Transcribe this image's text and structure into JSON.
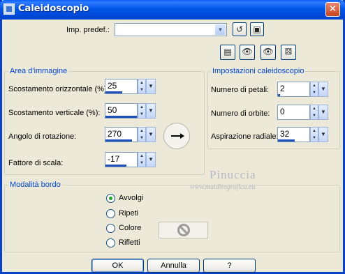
{
  "window": {
    "title": "Caleidoscopio",
    "close_glyph": "✕",
    "accent": "#0054e3"
  },
  "presets": {
    "label": "Imp. predef.:",
    "value": "",
    "icons": [
      "reset-icon",
      "save-icon"
    ]
  },
  "toolbar": {
    "icons": [
      "dialog-settings-icon",
      "preview-left-icon",
      "preview-right-icon",
      "random-dice-icon"
    ]
  },
  "image_area": {
    "title": "Area d'immagine",
    "fields": [
      {
        "label": "Scostamento orizzontale (%):",
        "value": "25"
      },
      {
        "label": "Scostamento verticale (%):",
        "value": "50"
      },
      {
        "label": "Angolo di rotazione:",
        "value": "270"
      },
      {
        "label": "Fattore di scala:",
        "value": "-17"
      }
    ]
  },
  "kaleido_settings": {
    "title": "Impostazioni caleidoscopio",
    "fields": [
      {
        "label": "Numero di petali:",
        "value": "2"
      },
      {
        "label": "Numero di orbite:",
        "value": "0"
      },
      {
        "label": "Aspirazione radiale:",
        "value": "32"
      }
    ]
  },
  "edge_mode": {
    "title": "Modalità bordo",
    "options": [
      {
        "label": "Avvolgi",
        "checked": true
      },
      {
        "label": "Ripeti",
        "checked": false
      },
      {
        "label": "Colore",
        "checked": false
      },
      {
        "label": "Rifletti",
        "checked": false
      }
    ]
  },
  "watermark": {
    "name": "Pinuccia",
    "site": "www.maidiregrafica.eu"
  },
  "buttons": {
    "ok": "OK",
    "cancel": "Annulla",
    "help": "?"
  }
}
